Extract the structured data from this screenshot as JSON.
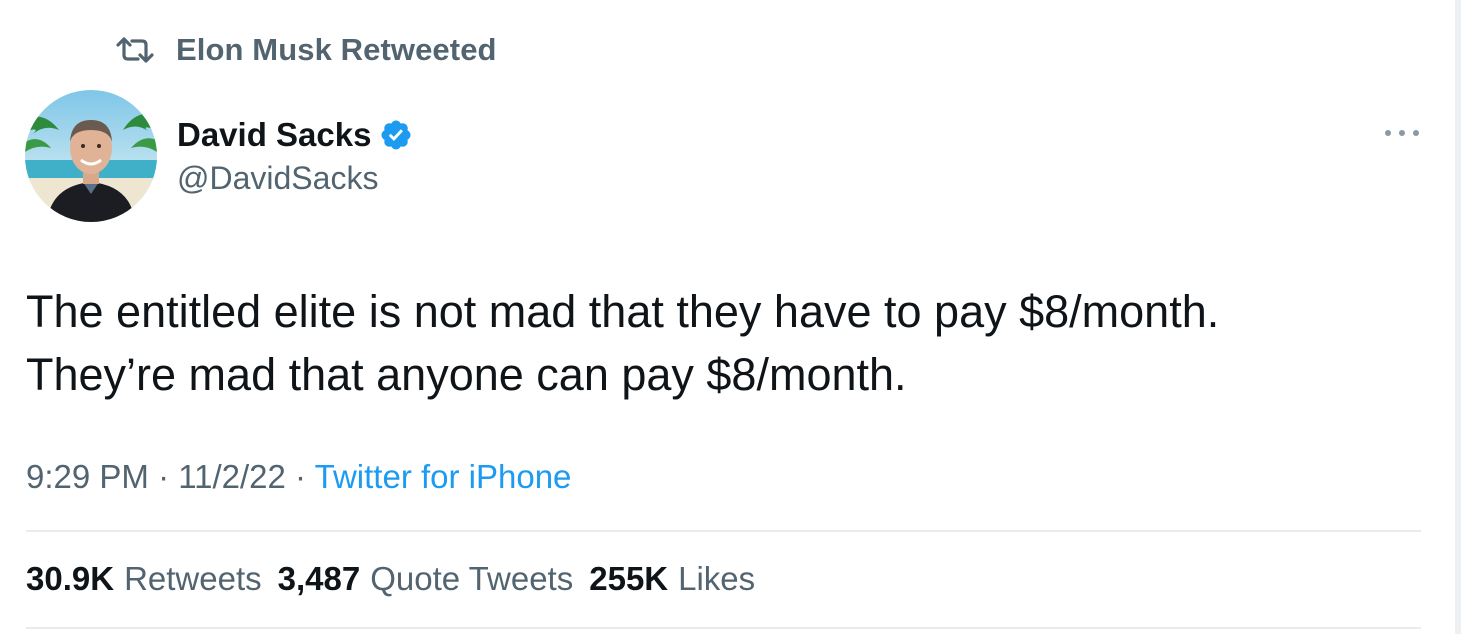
{
  "social_context": {
    "icon": "retweet-icon",
    "label": "Elon Musk Retweeted"
  },
  "author": {
    "avatar": "avatar-photo",
    "name": "David Sacks",
    "verified_icon": "verified-badge-icon",
    "handle": "@DavidSacks"
  },
  "more_icon": "more-options-icon",
  "tweet": {
    "lines": [
      "The entitled elite is not mad that they have to pay $8/month.",
      "They’re mad that anyone can pay $8/month."
    ],
    "time": "9:29 PM",
    "sep1": " · ",
    "date": "11/2/22",
    "sep2": " · ",
    "source": "Twitter for iPhone"
  },
  "stats": {
    "retweets_count": "30.9K",
    "retweets_label": "Retweets",
    "quotes_count": "3,487",
    "quotes_label": "Quote Tweets",
    "likes_count": "255K",
    "likes_label": "Likes"
  },
  "colors": {
    "text_primary": "#0f1419",
    "text_secondary": "#536471",
    "accent": "#1d9bf0",
    "divider": "#e6ecf0"
  }
}
